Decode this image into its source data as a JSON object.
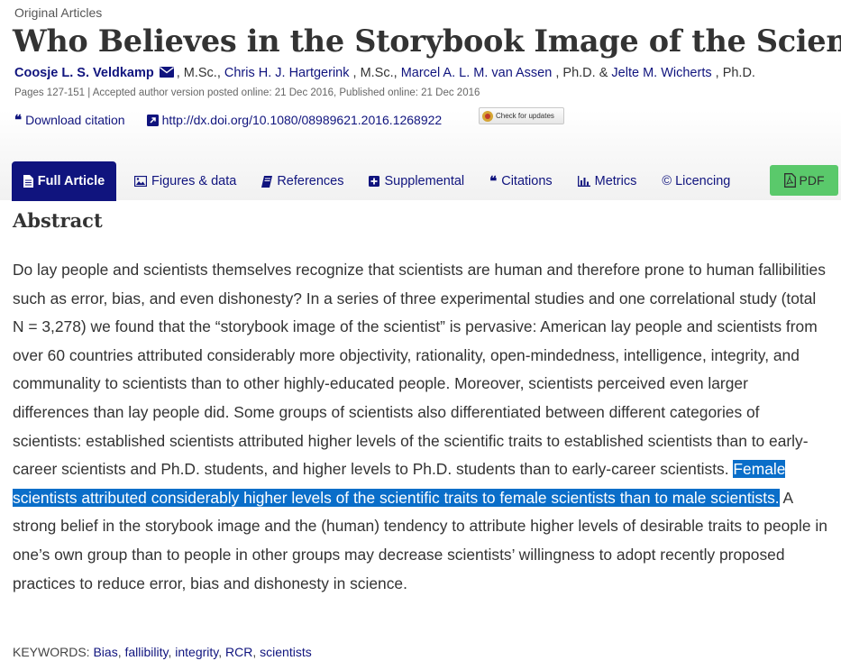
{
  "article_type": "Original Articles",
  "title": "Who Believes in the Storybook Image of the Scientist?",
  "authors": [
    {
      "name": "Coosje L. S. Veldkamp",
      "degree": ", M.Sc., "
    },
    {
      "name": "Chris H. J. Hartgerink",
      "degree": " , M.Sc., "
    },
    {
      "name": "Marcel A. L. M. van Assen",
      "degree": " , Ph.D. & "
    },
    {
      "name": "Jelte M. Wicherts",
      "degree": " , Ph.D."
    }
  ],
  "pub_info": "Pages 127-151 | Accepted author version posted online: 21 Dec 2016, Published online: 21 Dec 2016",
  "links": {
    "download_citation": "Download citation",
    "doi": "http://dx.doi.org/10.1080/08989621.2016.1268922",
    "check_updates": "Check for updates"
  },
  "tabs": [
    {
      "label": "Full Article",
      "icon": "document-icon"
    },
    {
      "label": "Figures & data",
      "icon": "image-icon"
    },
    {
      "label": "References",
      "icon": "book-icon"
    },
    {
      "label": "Supplemental",
      "icon": "plus-square-icon"
    },
    {
      "label": "Citations",
      "icon": "quote-icon"
    },
    {
      "label": "Metrics",
      "icon": "bar-chart-icon"
    },
    {
      "label": "© Licencing",
      "icon": "copyright-icon"
    }
  ],
  "pdf_label": "PDF",
  "abstract": {
    "heading": "Abstract",
    "text_before": "Do lay people and scientists themselves recognize that scientists are human and therefore prone to human fallibilities such as error, bias, and even dishonesty? In a series of three experimental studies and one correlational study (total N = 3,278) we found that the “storybook image of the scientist” is pervasive: American lay people and scientists from over 60 countries attributed considerably more objectivity, rationality, open-mindedness, intelligence, integrity, and communality to scientists than to other highly-educated people. Moreover, scientists perceived even larger differences than lay people did. Some groups of scientists also differentiated between different categories of scientists: established scientists attributed higher levels of the scientific traits to established scientists than to early-career scientists and Ph.D. students, and higher levels to Ph.D. students than to early-career scientists. ",
    "text_highlighted": "Female scientists attributed considerably higher levels of the scientific traits to female scientists than to male scientists.",
    "text_after": " A strong belief in the storybook image and the (human) tendency to attribute higher levels of desirable traits to people in one’s own group than to people in other groups may decrease scientists’ willingness to adopt recently proposed practices to reduce error, bias and dishonesty in science."
  },
  "keywords": {
    "label": "KEYWORDS: ",
    "items": [
      "Bias",
      "fallibility",
      "integrity",
      "RCR",
      "scientists"
    ],
    "separator": ", "
  },
  "colors": {
    "link": "#10147e",
    "active_tab": "#10147e",
    "pdf_button": "#5ac96b",
    "highlight": "#0a6ec9"
  }
}
